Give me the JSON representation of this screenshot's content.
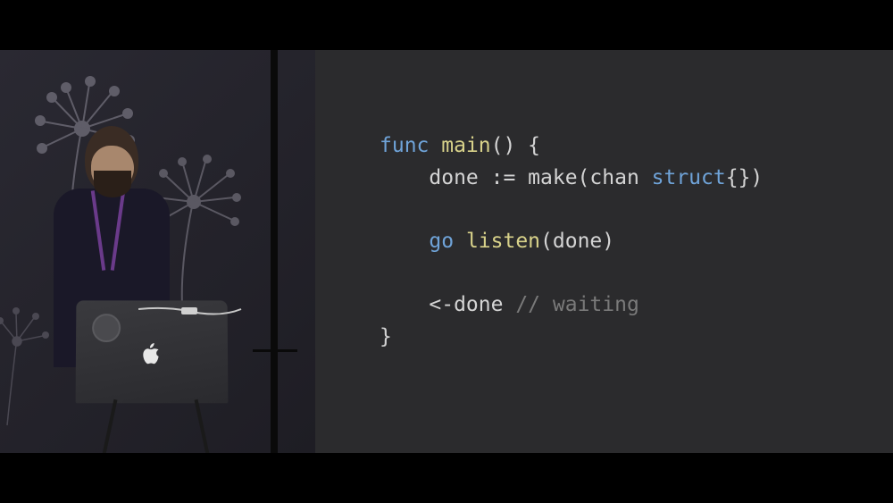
{
  "code": {
    "line1_kw": "func",
    "line1_fn": " main",
    "line1_rest": "() {",
    "line2": "    done := make(chan ",
    "line2_kw": "struct",
    "line2_rest": "{})",
    "line4_kw": "    go",
    "line4_fn": " listen",
    "line4_rest": "(done)",
    "line6": "    <-done ",
    "line6_comment": "// waiting",
    "line7": "}"
  },
  "presentation": {
    "speaker_description": "presenter with dark hair and beard wearing navy sweater",
    "laptop": "MacBook with Apple logo and circular sticker",
    "backdrop": "dark wall with dandelion seed-head illustrations"
  }
}
